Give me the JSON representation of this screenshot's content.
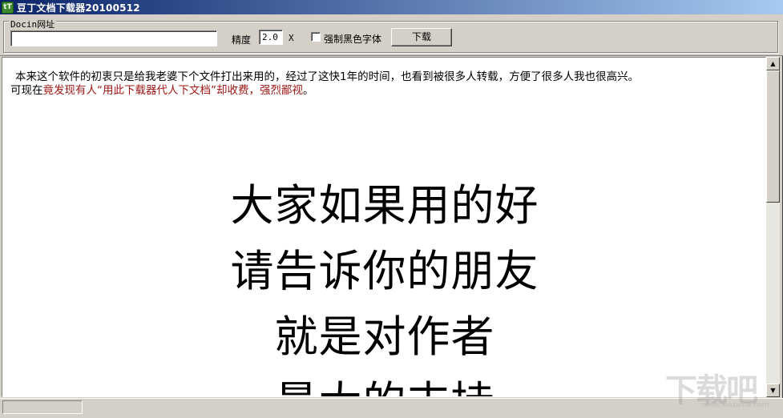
{
  "window": {
    "title": "豆丁文档下载器20100512",
    "icon_name": "app-icon",
    "icon_glyph": "tT"
  },
  "toolbar": {
    "group_label": "Docin网址",
    "url_value": "",
    "precision_label": "精度",
    "precision_value": "2.0",
    "precision_unit": "X",
    "force_black_label": "强制黑色字体",
    "force_black_checked": false,
    "download_label": "下载"
  },
  "content": {
    "intro_line1": "本来这个软件的初衷只是给我老婆下个文件打出来用的，经过了这快1年的时间，也看到被很多人转载，方便了很多人我也很高兴。",
    "intro_line2_prefix": "可现在",
    "intro_line2_red": "竟发现有人“用此下载器代人下文档”却收费，强烈鄙视",
    "intro_line2_suffix": "。",
    "big_lines": [
      "大家如果用的好",
      "请告诉你的朋友",
      "就是对作者",
      "最大的支持"
    ]
  },
  "watermark": {
    "text": "下载吧",
    "url": "www.xiazaiba.com"
  },
  "colors": {
    "titlebar_start": "#0a246a",
    "titlebar_end": "#a6caf0",
    "warning_red": "#a01818",
    "chrome": "#d4d0c8"
  }
}
